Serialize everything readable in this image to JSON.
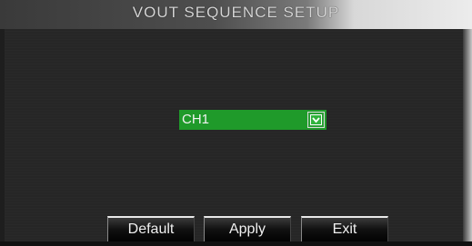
{
  "window": {
    "title": "VOUT SEQUENCE SETUP"
  },
  "channel_select": {
    "value": "CH1",
    "icon": "chevron-down-icon"
  },
  "buttons": {
    "default_label": "Default",
    "apply_label": "Apply",
    "exit_label": "Exit"
  },
  "colors": {
    "select_green": "#1f9a2a",
    "background": "#262626"
  }
}
